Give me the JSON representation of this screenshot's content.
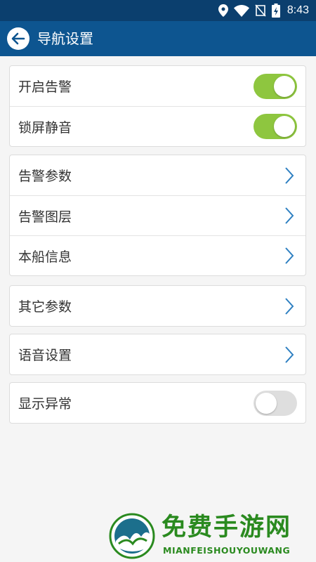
{
  "status_bar": {
    "time": "8:43",
    "icons": [
      "location-icon",
      "wifi-icon",
      "no-sim-icon",
      "battery-charging-icon"
    ]
  },
  "app_bar": {
    "title": "导航设置",
    "back_icon": "back-arrow-icon"
  },
  "settings": {
    "group1": [
      {
        "label": "开启告警",
        "toggle": true
      },
      {
        "label": "锁屏静音",
        "toggle": true
      }
    ],
    "group2": [
      {
        "label": "告警参数"
      },
      {
        "label": "告警图层"
      },
      {
        "label": "本船信息"
      }
    ],
    "group3": [
      {
        "label": "其它参数"
      }
    ],
    "group4": [
      {
        "label": "语音设置"
      }
    ],
    "group5": [
      {
        "label": "显示异常",
        "toggle": false
      }
    ]
  },
  "watermark": {
    "title": "免费手游网",
    "subtitle": "MIANFEISHOUYOUWANG"
  },
  "colors": {
    "status_bar": "#0b3f6e",
    "app_bar": "#0d5590",
    "toggle_on": "#8ec63f",
    "toggle_off": "#dedede",
    "chevron": "#2d7fc1",
    "watermark": "#2a8a1f"
  }
}
